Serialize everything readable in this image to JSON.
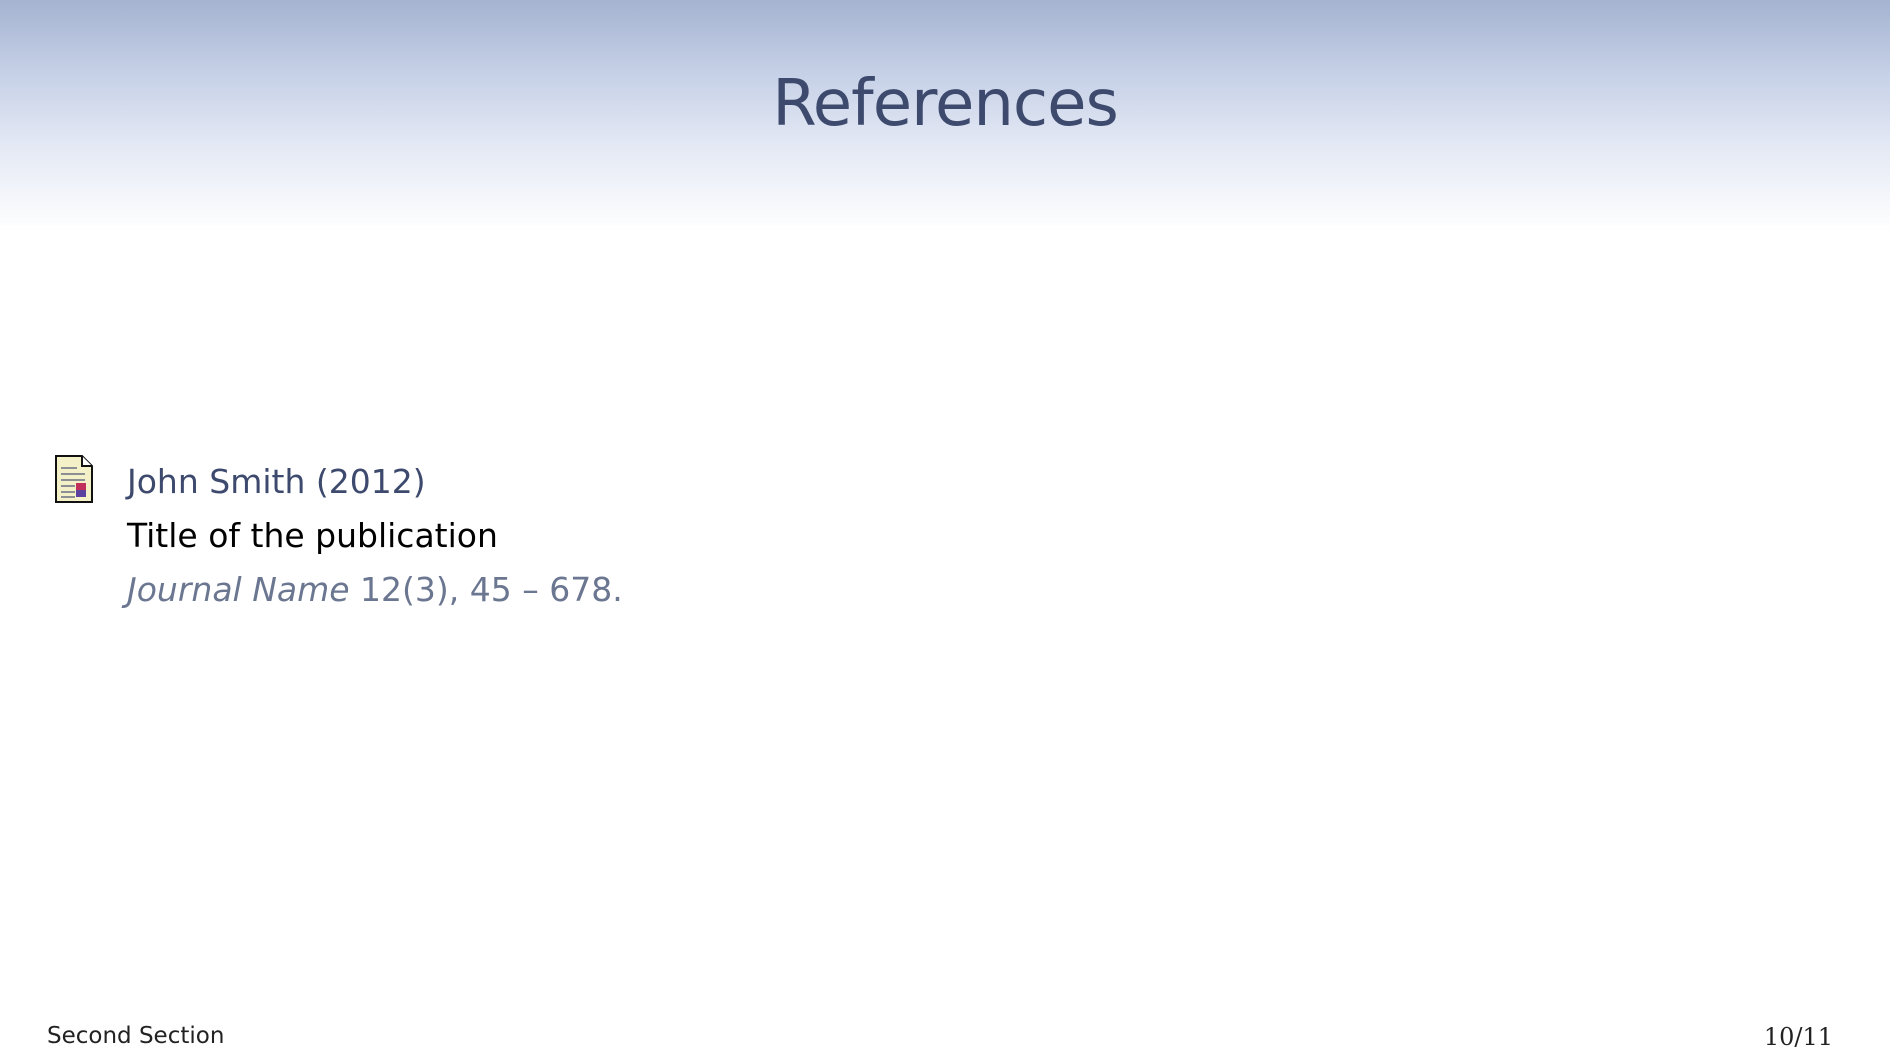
{
  "slide": {
    "title": "References"
  },
  "reference": {
    "icon": "article-icon",
    "author_year": "John Smith (2012)",
    "title": "Title of the publication",
    "journal": "Journal Name",
    "details": " 12(3), 45 – 678."
  },
  "footer": {
    "section": "Second Section",
    "page": "10/11"
  },
  "colors": {
    "title": "#3d4a6e",
    "header_top": "#a5b3d1",
    "journal_text": "#6b7690"
  }
}
